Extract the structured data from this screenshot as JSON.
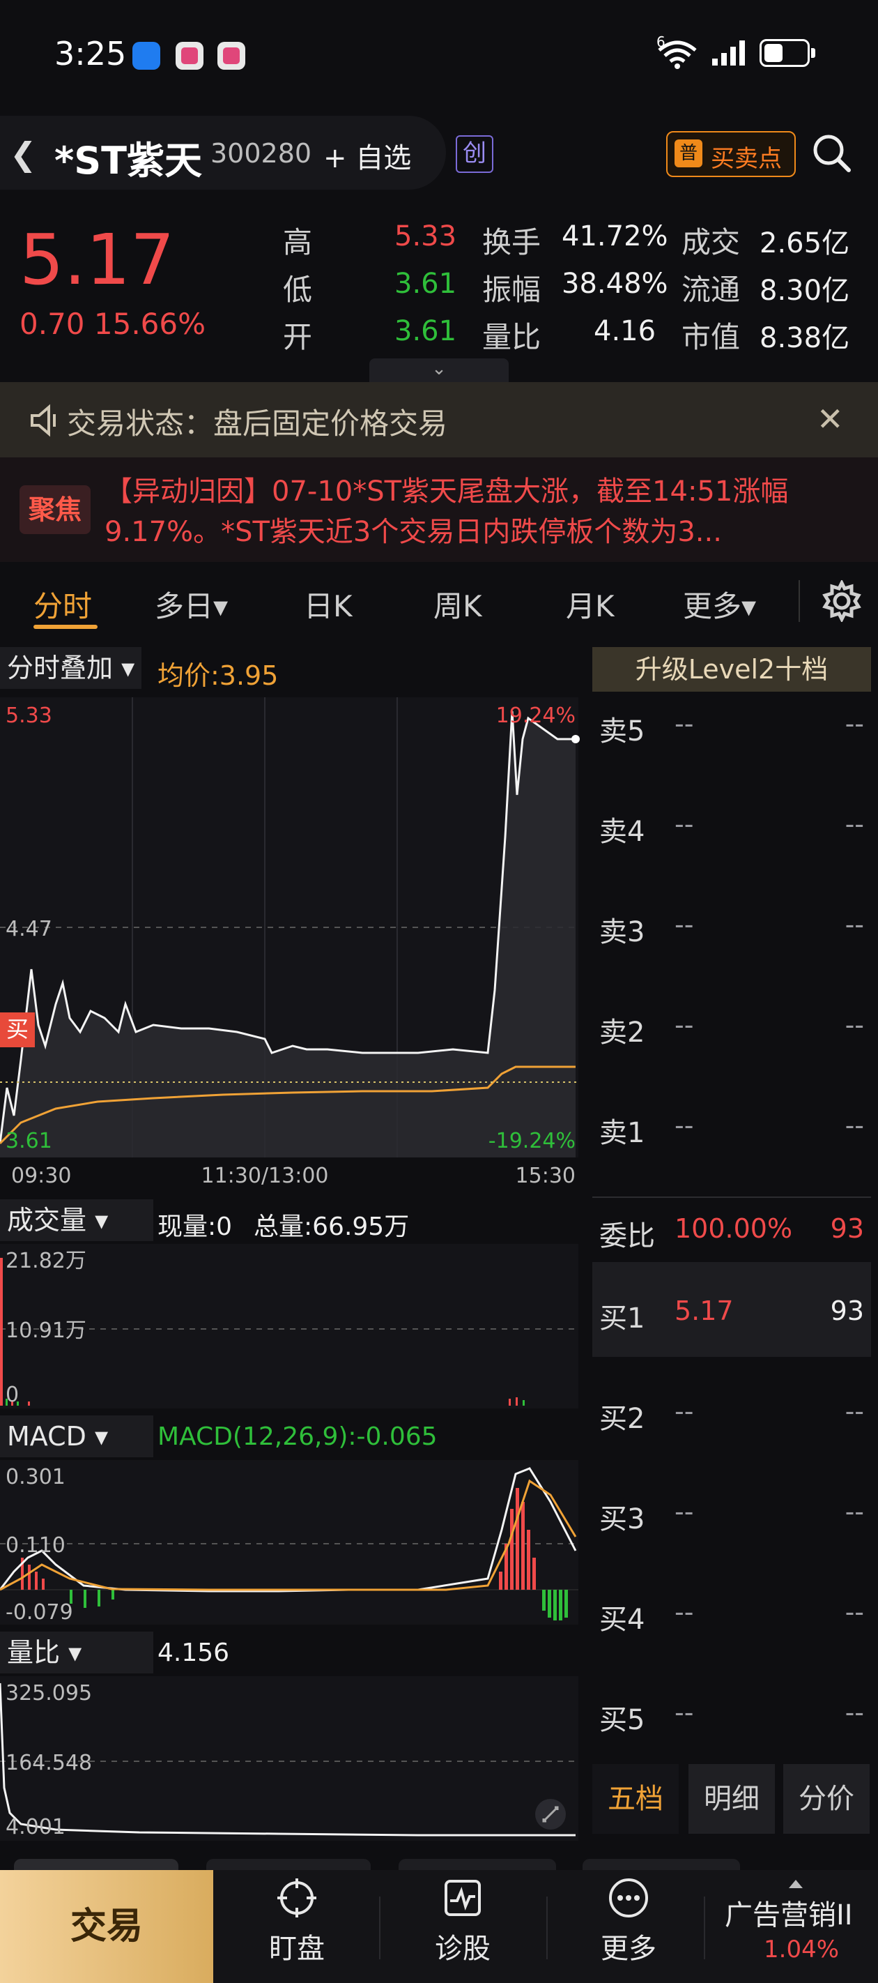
{
  "status_bar": {
    "time": "3:25",
    "wifi_badge": "6"
  },
  "header": {
    "stock_name": "*ST紫天",
    "stock_code": "300280",
    "add_watch": "+ 自选",
    "board_badge": "创",
    "buysell_icon": "普",
    "buysell_label": "买卖点"
  },
  "quote": {
    "price": "5.17",
    "change": "0.70",
    "change_pct": "15.66%",
    "high_label": "高",
    "high": "5.33",
    "low_label": "低",
    "low": "3.61",
    "open_label": "开",
    "open": "3.61",
    "turnover_label": "换手",
    "turnover": "41.72%",
    "amplitude_label": "振幅",
    "amplitude": "38.48%",
    "vol_ratio_label": "量比",
    "vol_ratio": "4.16",
    "amount_label": "成交",
    "amount": "2.65亿",
    "float_cap_label": "流通",
    "float_cap": "8.30亿",
    "mkt_cap_label": "市值",
    "mkt_cap": "8.38亿",
    "colors": {
      "up": "#f04a4a",
      "down": "#2fbf3a"
    }
  },
  "trade_status": {
    "text": "交易状态：盘后固定价格交易"
  },
  "news": {
    "badge": "聚焦",
    "text": "【异动归因】07-10*ST紫天尾盘大涨，截至14:51涨幅9.17%。*ST紫天近3个交易日内跌停板个数为3..."
  },
  "tabs": {
    "items": [
      "分时",
      "多日▾",
      "日K",
      "周K",
      "月K",
      "更多▾"
    ],
    "active": "分时"
  },
  "intraday": {
    "overlay_selector": "分时叠加 ▾",
    "avg_price_label": "均价:3.95",
    "y_top": "5.33",
    "y_mid": "4.47",
    "y_bottom": "3.61",
    "pct_top": "19.24%",
    "pct_bottom": "-19.24%",
    "x_labels": [
      "09:30",
      "11:30/13:00",
      "15:30"
    ],
    "buy_marker": "买"
  },
  "volume": {
    "selector": "成交量 ▾",
    "current": "现量:0",
    "total": "总量:66.95万",
    "y_top": "21.82万",
    "y_mid": "10.91万",
    "y_bottom": "0"
  },
  "macd": {
    "selector": "MACD ▾",
    "value": "MACD(12,26,9):-0.065",
    "y_top": "0.301",
    "y_mid": "0.110",
    "y_bottom": "-0.079"
  },
  "volratio": {
    "selector": "量比 ▾",
    "value": "4.156",
    "y_top": "325.095",
    "y_mid": "164.548",
    "y_bottom": "4.001"
  },
  "chart_data": {
    "type": "line",
    "x_range": [
      "09:30",
      "15:30"
    ],
    "ylim": [
      3.61,
      5.33
    ],
    "series": [],
    "note_markers": {
      "high": "5.33",
      "low": "3.61"
    }
  },
  "orderbook": {
    "header": "升级Level2十档",
    "asks": [
      {
        "label": "卖5",
        "price": "--",
        "vol": "--"
      },
      {
        "label": "卖4",
        "price": "--",
        "vol": "--"
      },
      {
        "label": "卖3",
        "price": "--",
        "vol": "--"
      },
      {
        "label": "卖2",
        "price": "--",
        "vol": "--"
      },
      {
        "label": "卖1",
        "price": "--",
        "vol": "--"
      }
    ],
    "ratio": {
      "label": "委比",
      "pct": "100.00%",
      "vol": "93"
    },
    "bids": [
      {
        "label": "买1",
        "price": "5.17",
        "vol": "93"
      },
      {
        "label": "买2",
        "price": "--",
        "vol": "--"
      },
      {
        "label": "买3",
        "price": "--",
        "vol": "--"
      },
      {
        "label": "买4",
        "price": "--",
        "vol": "--"
      },
      {
        "label": "买5",
        "price": "--",
        "vol": "--"
      }
    ],
    "tabs": [
      "五档",
      "明细",
      "分价"
    ]
  },
  "bottom_nav": {
    "trade": "交易",
    "items": [
      "盯盘",
      "诊股",
      "更多"
    ],
    "ad_label": "广告营销II",
    "ad_pct": "1.04%"
  }
}
